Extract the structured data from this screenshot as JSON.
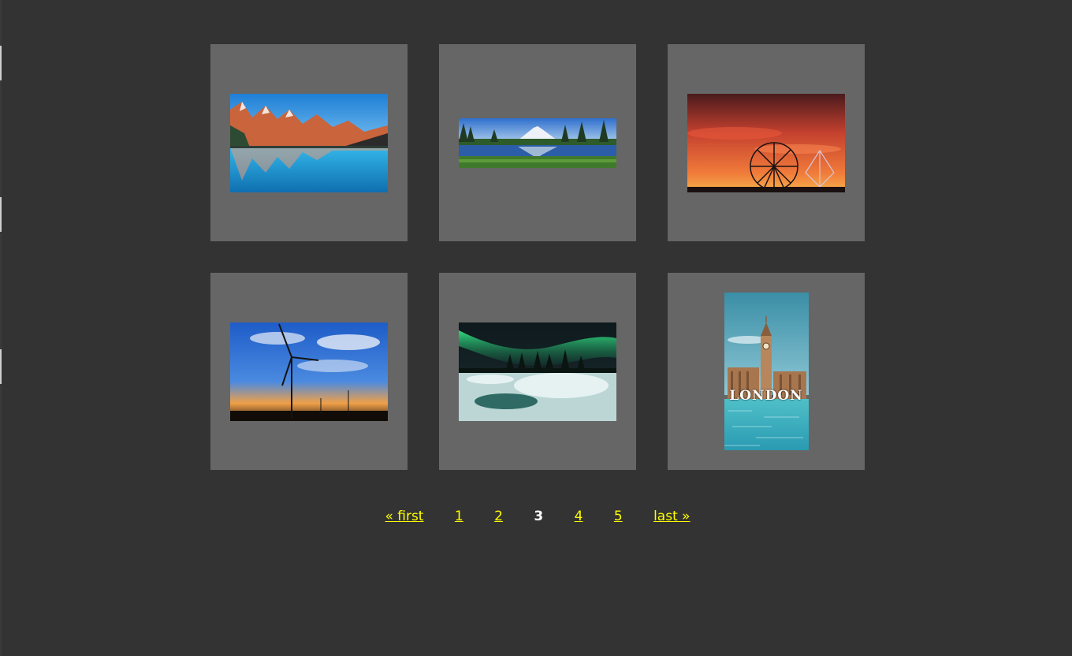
{
  "gallery": {
    "images": [
      {
        "subject": "mountain lake reflection"
      },
      {
        "subject": "alpine lake panorama"
      },
      {
        "subject": "ferris wheel at sunset"
      },
      {
        "subject": "wind turbine at sunset"
      },
      {
        "subject": "aurora over frozen river"
      },
      {
        "subject": "london big ben",
        "caption": "LONDON"
      }
    ]
  },
  "pagination": {
    "first_label": "« first",
    "pages": [
      "1",
      "2",
      "3",
      "4",
      "5"
    ],
    "current": "3",
    "last_label": "last »"
  },
  "colors": {
    "background": "#333333",
    "tile": "#666666",
    "link": "#ffff00",
    "current": "#ffffff"
  }
}
